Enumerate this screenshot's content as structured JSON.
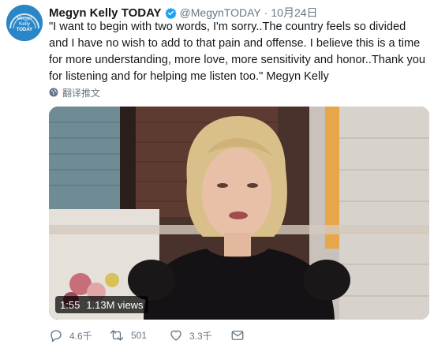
{
  "account": {
    "display_name": "Megyn Kelly TODAY",
    "handle": "@MegynTODAY",
    "separator": "·",
    "date": "10月24日",
    "avatar_icon": "today-logo-icon",
    "avatar_text_1": "Megyn",
    "avatar_text_2": "Kelly",
    "avatar_text_3": "TODAY"
  },
  "tweet": {
    "text": "\"I want to begin with two words, I'm sorry..The country feels so divided and I have no wish to add to that pain and offense. I believe this is a time for more understanding, more love, more sensitivity and honor..Thank you for listening and for helping me listen too.\" Megyn Kelly",
    "translate_label": "翻译推文"
  },
  "media": {
    "duration": "1:55",
    "views": "1.13M views"
  },
  "actions": {
    "reply_count": "4.6千",
    "retweet_count": "501",
    "like_count": "3.3千"
  },
  "colors": {
    "brand_blue": "#1da1f2",
    "muted_text": "#657786",
    "avatar_bg": "#2a86c6"
  }
}
